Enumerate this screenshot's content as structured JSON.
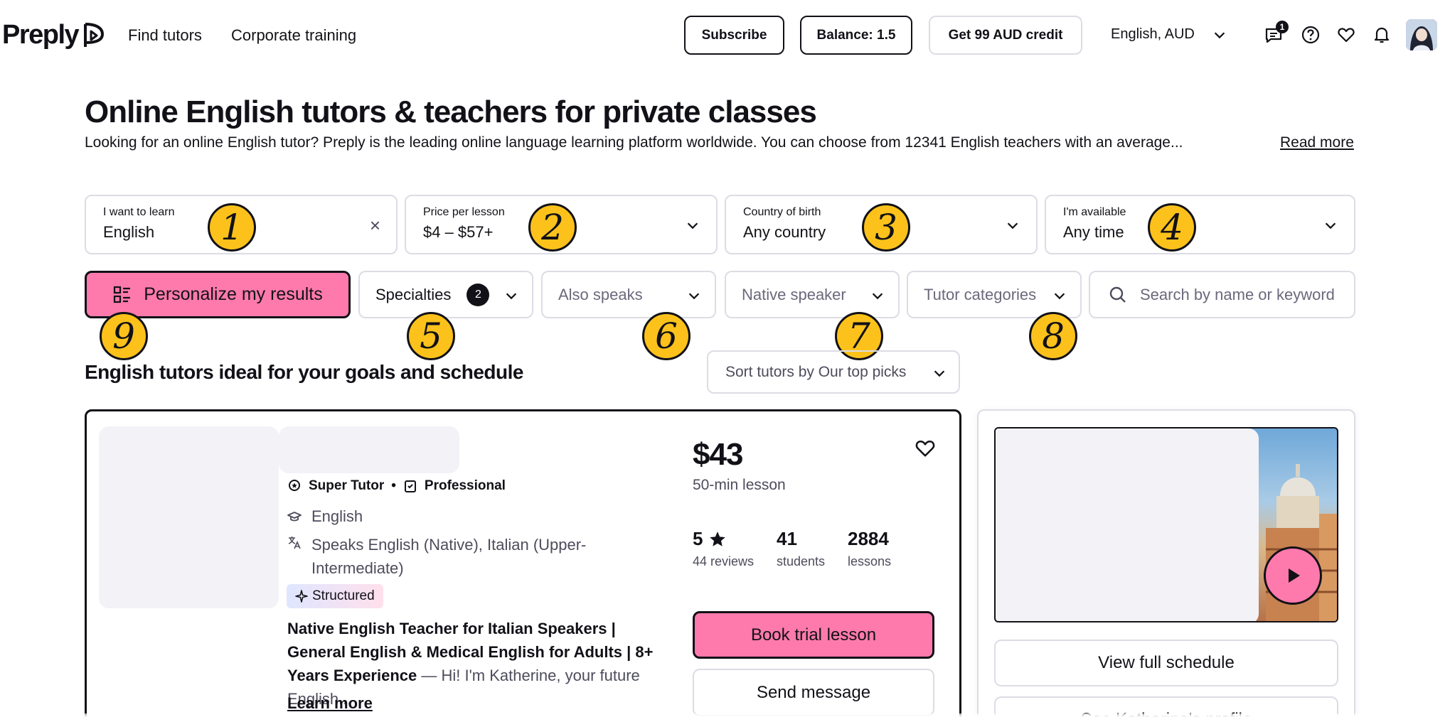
{
  "header": {
    "logo_text": "Preply",
    "nav": [
      "Find tutors",
      "Corporate training"
    ],
    "subscribe_label": "Subscribe",
    "balance_label": "Balance: 1.5",
    "credit_label": "Get 99 AUD credit",
    "language_currency": "English, AUD",
    "messages_badge": "1",
    "icons": [
      "messages-icon",
      "help-icon",
      "heart-icon",
      "bell-icon"
    ]
  },
  "hero": {
    "title": "Online English tutors & teachers for private classes",
    "description": "Looking for an online English tutor? Preply is the leading online language learning platform worldwide. You can choose from 12341 English teachers with an average...",
    "read_more": "Read more"
  },
  "filters": [
    {
      "label": "I want to learn",
      "value": "English",
      "clearable": true
    },
    {
      "label": "Price per lesson",
      "value": "$4 – $57+"
    },
    {
      "label": "Country of birth",
      "value": "Any country"
    },
    {
      "label": "I'm available",
      "value": "Any time"
    }
  ],
  "filters_row2": {
    "personalize_label": "Personalize my results",
    "specialties_label": "Specialties",
    "specialties_count": "2",
    "also_speaks_label": "Also speaks",
    "native_speaker_label": "Native speaker",
    "tutor_categories_label": "Tutor categories",
    "search_placeholder": "Search by name or keyword"
  },
  "markers": [
    "1",
    "2",
    "3",
    "4",
    "5",
    "6",
    "7",
    "8",
    "9"
  ],
  "results": {
    "title": "English tutors ideal for your goals and schedule",
    "sort_label": "Sort tutors by Our top picks"
  },
  "tutor_card": {
    "badge_super": "Super Tutor",
    "badge_separator": "•",
    "badge_professional": "Professional",
    "subject": "English",
    "speaks": "Speaks English (Native), Italian (Upper-Intermediate)",
    "structured_label": "Structured",
    "headline": "Native English Teacher for Italian Speakers | General English & Medical English for Adults | 8+ Years Experience",
    "snippet": " — Hi! I'm Katherine, your future English...",
    "learn_more": "Learn more",
    "price": "$43",
    "price_sub": "50-min lesson",
    "rating": "5",
    "reviews": "44 reviews",
    "students_count": "41",
    "students_label": "students",
    "lessons_count": "2884",
    "lessons_label": "lessons",
    "trial_button": "Book trial lesson",
    "message_button": "Send message"
  },
  "side_card": {
    "schedule_button": "View full schedule",
    "profile_button": "See Katherine's profile"
  },
  "colors": {
    "accent_pink": "#ff7aac",
    "marker_yellow": "#fcc21b",
    "text_dark": "#121117",
    "border_light": "#dcdce5"
  }
}
